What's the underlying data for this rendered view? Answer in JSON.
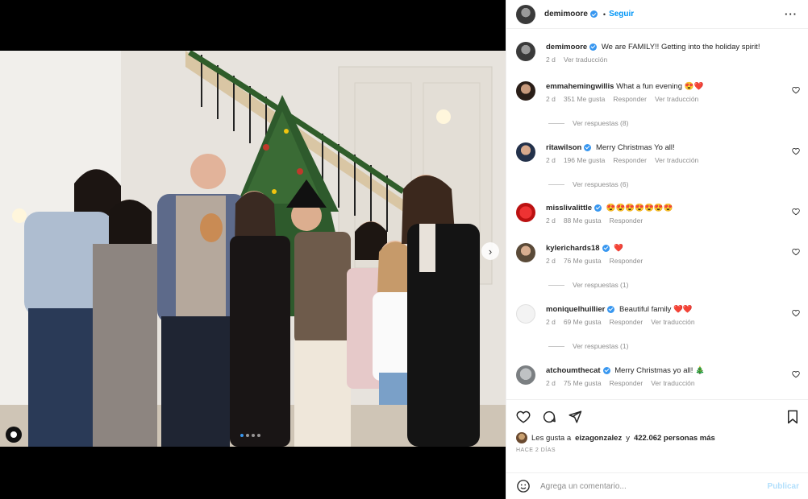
{
  "post": {
    "author": "demimoore",
    "follow_label": "Seguir",
    "separator": "•",
    "more_label": "···"
  },
  "caption": {
    "author": "demimoore",
    "text": "We are FAMILY!! Getting into the holiday spirit!",
    "time": "2 d",
    "translate": "Ver traducción"
  },
  "comments": [
    {
      "user": "emmahemingwillis",
      "text": "What a fun evening",
      "emoji": "😍❤️",
      "time": "2 d",
      "likes": "351 Me gusta",
      "reply": "Responder",
      "translate": "Ver traducción",
      "replies": "Ver respuestas (8)",
      "verified": true
    },
    {
      "user": "ritawilson",
      "text": "Merry Christmas Yo all!",
      "emoji": "",
      "time": "2 d",
      "likes": "196 Me gusta",
      "reply": "Responder",
      "translate": "Ver traducción",
      "replies": "Ver respuestas (6)",
      "verified": true
    },
    {
      "user": "misslivalittle",
      "text": "",
      "emoji": "😍😍😍😍😍😍😍",
      "time": "2 d",
      "likes": "88 Me gusta",
      "reply": "Responder",
      "translate": "",
      "replies": "",
      "verified": true
    },
    {
      "user": "kylerichards18",
      "text": "",
      "emoji": "❤️",
      "time": "2 d",
      "likes": "76 Me gusta",
      "reply": "Responder",
      "translate": "",
      "replies": "Ver respuestas (1)",
      "verified": true
    },
    {
      "user": "moniquelhuillier",
      "text": "Beautiful family",
      "emoji": "❤️❤️",
      "time": "2 d",
      "likes": "69 Me gusta",
      "reply": "Responder",
      "translate": "Ver traducción",
      "replies": "Ver respuestas (1)",
      "verified": true
    },
    {
      "user": "atchoumthecat",
      "text": "Merry Christmas yo all!",
      "emoji": "🎄",
      "time": "2 d",
      "likes": "75 Me gusta",
      "reply": "Responder",
      "translate": "Ver traducción",
      "replies": "",
      "verified": true
    }
  ],
  "likes_line": {
    "prefix": "Les gusta a",
    "user": "eizagonzalez",
    "middle": "y",
    "count": "422.062 personas más"
  },
  "posted_ago": "HACE 2 DÍAS",
  "add_comment": {
    "placeholder": "Agrega un comentario...",
    "publish": "Publicar"
  },
  "colors": {
    "accent": "#0095f6",
    "verified": "#3897f0",
    "heart": "#e0245e"
  }
}
